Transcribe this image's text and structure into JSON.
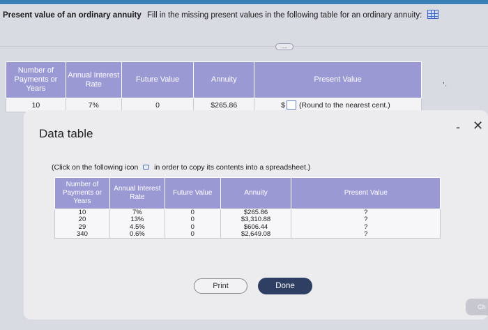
{
  "header": {
    "title": "Present value of an ordinary annuity",
    "instruction": "Fill in the missing present values in the following table for an ordinary annuity:",
    "icon": "grid-icon"
  },
  "divider_label": "....",
  "main_table": {
    "columns": [
      "Number of Payments or Years",
      "Annual Interest Rate",
      "Future Value",
      "Annuity",
      "Present Value"
    ],
    "row": {
      "years": "10",
      "rate": "7%",
      "future_value": "0",
      "annuity": "$265.86",
      "currency": "$",
      "hint": "(Round to the nearest cent.)"
    }
  },
  "modal": {
    "title": "Data table",
    "minimize": "-",
    "close": "✕",
    "instruction_before": "(Click on the following icon",
    "instruction_after": "in order to copy its contents into a spreadsheet.)",
    "columns": [
      "Number of Payments or Years",
      "Annual Interest Rate",
      "Future Value",
      "Annuity",
      "Present Value"
    ],
    "rows": [
      {
        "years": "10",
        "rate": "7%",
        "fv": "0",
        "annuity": "$265.86",
        "pv": "?"
      },
      {
        "years": "20",
        "rate": "13%",
        "fv": "0",
        "annuity": "$3,310.88",
        "pv": "?"
      },
      {
        "years": "29",
        "rate": "4.5%",
        "fv": "0",
        "annuity": "$606.44",
        "pv": "?"
      },
      {
        "years": "340",
        "rate": "0.6%",
        "fv": "0",
        "annuity": "$2,649.08",
        "pv": "?"
      }
    ],
    "print_label": "Print",
    "done_label": "Done"
  },
  "side_marks": [
    ",",
    "'"
  ],
  "check_button": "Ch",
  "colors": {
    "header_fill": "#9b99d4",
    "done_button": "#2f3f63",
    "top_bar": "#3a7fb5"
  }
}
